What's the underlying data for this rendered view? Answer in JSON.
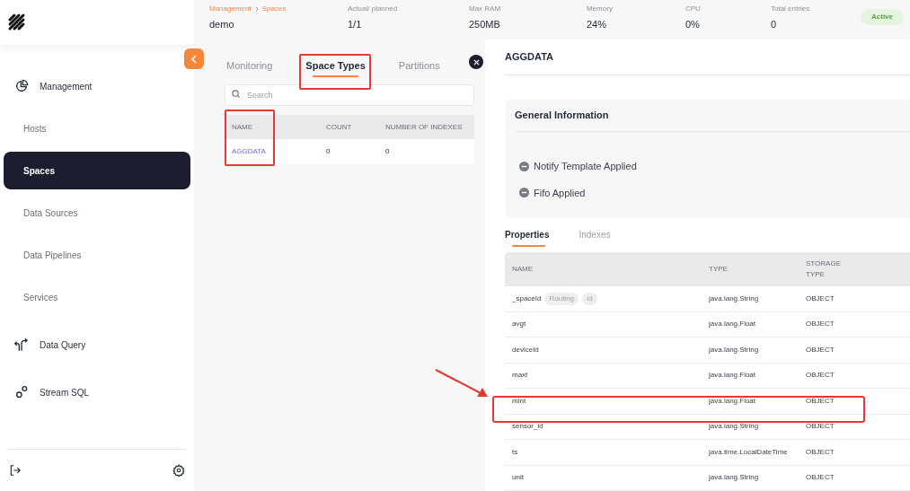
{
  "header": {
    "breadcrumb": [
      {
        "label": "Management"
      },
      {
        "label": "Spaces"
      }
    ],
    "name": "demo",
    "stats": [
      {
        "label": "Actual/ planned",
        "value": "1/1"
      },
      {
        "label": "Max RAM",
        "value": "250MB"
      },
      {
        "label": "Memory",
        "value": "24%"
      },
      {
        "label": "CPU",
        "value": "0%"
      },
      {
        "label": "Total entries",
        "value": "0"
      }
    ],
    "status": "Active"
  },
  "sidebar": {
    "items": [
      {
        "label": "Management",
        "kind": "section",
        "selected": false
      },
      {
        "label": "Hosts",
        "kind": "sub",
        "selected": false
      },
      {
        "label": "Spaces",
        "kind": "sub",
        "selected": true
      },
      {
        "label": "Data Sources",
        "kind": "sub",
        "selected": false
      },
      {
        "label": "Data Pipelines",
        "kind": "sub",
        "selected": false
      },
      {
        "label": "Services",
        "kind": "sub",
        "selected": false
      },
      {
        "label": "Data Query",
        "kind": "section",
        "selected": false
      },
      {
        "label": "Stream SQL",
        "kind": "section",
        "selected": false
      }
    ]
  },
  "space_types_panel": {
    "tabs": [
      {
        "label": "Monitoring",
        "selected": false
      },
      {
        "label": "Space Types",
        "selected": true
      },
      {
        "label": "Partitions",
        "selected": false
      }
    ],
    "search": {
      "placeholder": "Search"
    },
    "table": {
      "columns": [
        "NAME",
        "COUNT",
        "NUMBER OF INDEXES"
      ],
      "rows": [
        [
          "AGGDATA",
          "0",
          "0"
        ]
      ]
    }
  },
  "detail": {
    "title": "AGGDATA",
    "general_information": {
      "title": "General Information",
      "items": [
        {
          "label": "Notify Template Applied"
        },
        {
          "label": "Fifo Applied"
        }
      ]
    },
    "tabs": [
      {
        "label": "Properties",
        "selected": true
      },
      {
        "label": "Indexes",
        "selected": false
      }
    ],
    "properties": {
      "columns": [
        "NAME",
        "TYPE",
        "STORAGE TYPE"
      ],
      "rows": [
        {
          "name": "_spaceId",
          "tags": [
            "Routing",
            "Id"
          ],
          "type": "java.lang.String",
          "storage": "OBJECT"
        },
        {
          "name": "avgt",
          "type": "java.lang.Float",
          "storage": "OBJECT"
        },
        {
          "name": "deviceId",
          "type": "java.lang.String",
          "storage": "OBJECT"
        },
        {
          "name": "maxt",
          "type": "java.lang.Float",
          "storage": "OBJECT"
        },
        {
          "name": "mint",
          "type": "java.lang.Float",
          "storage": "OBJECT"
        },
        {
          "name": "sensor_id",
          "type": "java.lang.String",
          "storage": "OBJECT"
        },
        {
          "name": "ts",
          "type": "java.time.LocalDateTime",
          "storage": "OBJECT"
        },
        {
          "name": "unit",
          "type": "java.lang.String",
          "storage": "OBJECT"
        }
      ]
    }
  }
}
